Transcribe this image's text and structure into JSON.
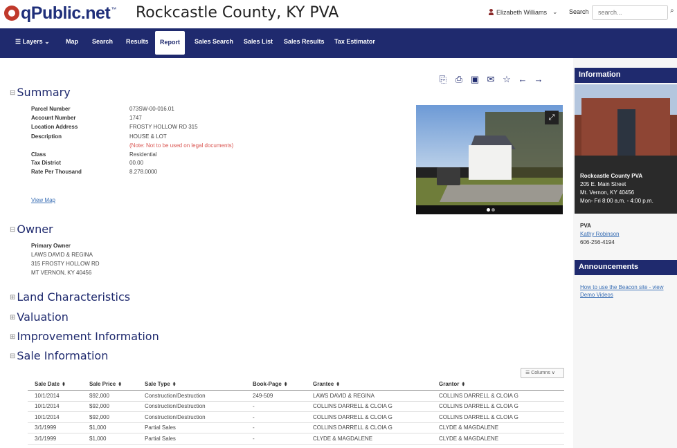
{
  "header": {
    "logo": "qPublic.net",
    "logo_tm": "™",
    "site_title": "Rockcastle County, KY PVA",
    "user_name": "Elizabeth Williams",
    "search_label": "Search",
    "search_placeholder": "search..."
  },
  "nav": {
    "layers": "☰ Layers ⌄",
    "map": "Map",
    "search": "Search",
    "results": "Results",
    "report": "Report",
    "sales_search": "Sales Search",
    "sales_list": "Sales List",
    "sales_results": "Sales Results",
    "tax_estimator": "Tax Estimator"
  },
  "summary": {
    "title": "Summary",
    "fields": [
      {
        "label": "Parcel Number",
        "value": "073SW-00-016.01"
      },
      {
        "label": "Account Number",
        "value": "1747"
      },
      {
        "label": "Location Address",
        "value": "FROSTY HOLLOW RD 315"
      },
      {
        "label": "Description",
        "value": "HOUSE & LOT"
      },
      {
        "label": "Class",
        "value": "Residential"
      },
      {
        "label": "Tax District",
        "value": "00.00"
      },
      {
        "label": "Rate Per Thousand",
        "value": "8.278.0000"
      }
    ],
    "description_note": "(Note: Not to be used on legal documents)",
    "view_map": "View Map"
  },
  "owner": {
    "title": "Owner",
    "label": "Primary Owner",
    "lines": [
      "LAWS DAVID & REGINA",
      "315 FROSTY HOLLOW RD",
      "MT VERNON, KY 40456"
    ]
  },
  "sections": {
    "land": "Land Characteristics",
    "valuation": "Valuation",
    "improvement": "Improvement Information",
    "sale": "Sale Information"
  },
  "sales": {
    "columns_button": "☰ Columns ∨",
    "headers": [
      "Sale Date",
      "Sale Price",
      "Sale Type",
      "Book-Page",
      "Grantee",
      "Grantor"
    ],
    "rows": [
      [
        "10/1/2014",
        "$92,000",
        "Construction/Destruction",
        "249-509",
        "LAWS DAVID & REGINA",
        "COLLINS DARRELL & CLOIA G"
      ],
      [
        "10/1/2014",
        "$92,000",
        "Construction/Destruction",
        "-",
        "COLLINS DARRELL & CLOIA G",
        "COLLINS DARRELL & CLOIA G"
      ],
      [
        "10/1/2014",
        "$92,000",
        "Construction/Destruction",
        "-",
        "COLLINS DARRELL & CLOIA G",
        "COLLINS DARRELL & CLOIA G"
      ],
      [
        "3/1/1999",
        "$1,000",
        "Partial Sales",
        "-",
        "COLLINS DARRELL & CLOIA G",
        "CLYDE & MAGDALENE"
      ],
      [
        "3/1/1999",
        "$1,000",
        "Partial Sales",
        "-",
        "CLYDE & MAGDALENE",
        "CLYDE & MAGDALENE"
      ]
    ]
  },
  "sidebar": {
    "information_title": "Information",
    "office_name": "Rockcastle County PVA",
    "address1": "205 E. Main Street",
    "address2": "Mt. Vernon, KY 40456",
    "hours": "Mon- Fri 8:00 a.m. - 4:00 p.m.",
    "pva_label": "PVA",
    "pva_name": "Kathy Robinson",
    "pva_phone": "606-256-4194",
    "announcements_title": "Announcements",
    "announcement_link": "How to use the Beacon site - view Demo Videos"
  },
  "colors": {
    "navy": "#1f2a6e",
    "brand_red": "#c0392b",
    "link": "#3a6fb5",
    "note_red": "#d9534f"
  }
}
